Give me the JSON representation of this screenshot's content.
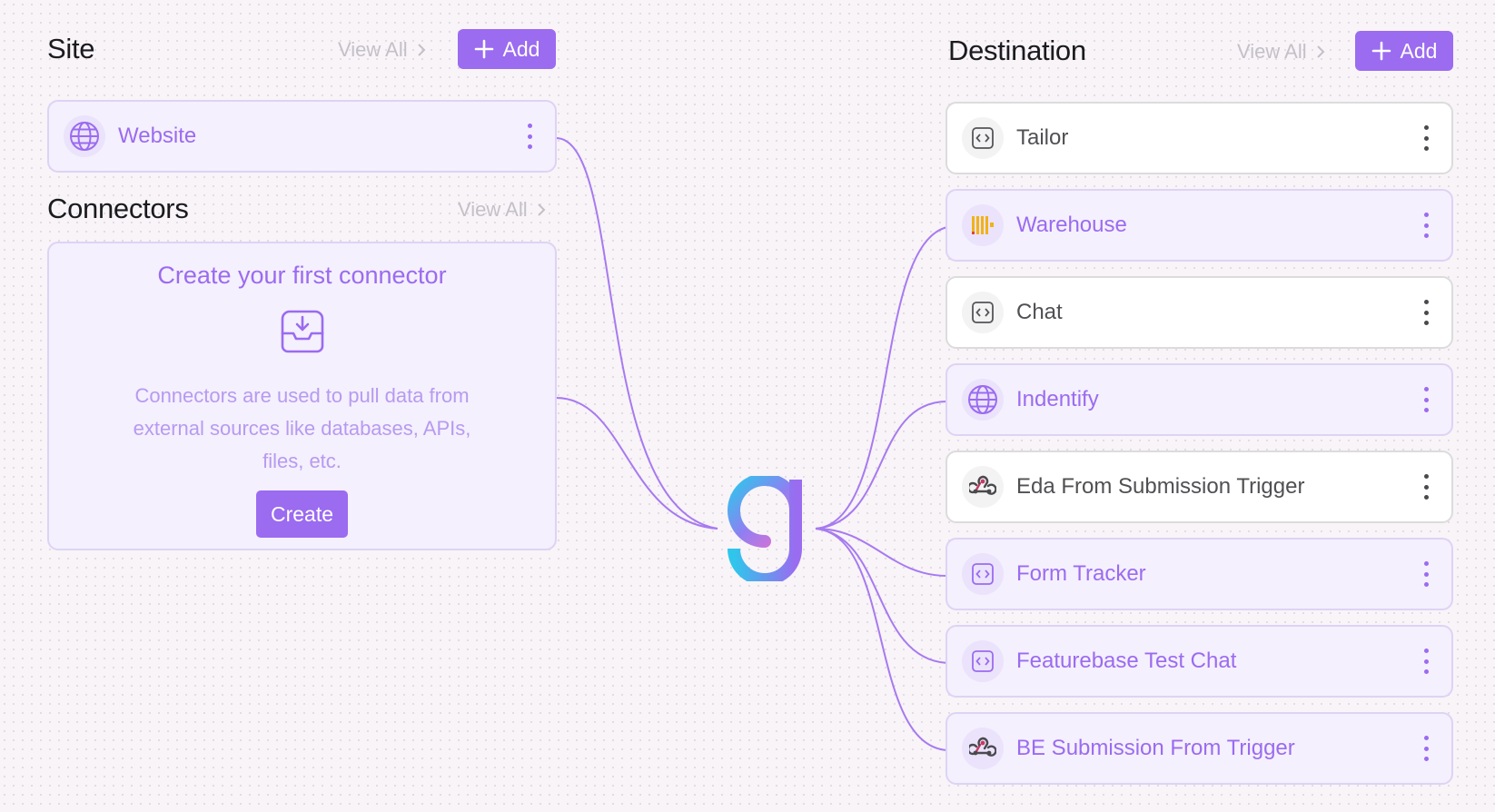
{
  "site": {
    "title": "Site",
    "view_all": "View All",
    "add_label": "Add",
    "items": [
      {
        "label": "Website",
        "icon": "globe-icon"
      }
    ]
  },
  "connectors": {
    "title": "Connectors",
    "view_all": "View All",
    "empty_title": "Create your first connector",
    "empty_description": "Connectors are used to pull data from external sources like databases, APIs, files, etc.",
    "create_label": "Create",
    "empty_icon": "inbox-download-icon"
  },
  "destination": {
    "title": "Destination",
    "view_all": "View All",
    "add_label": "Add",
    "items": [
      {
        "label": "Tailor",
        "icon": "code-icon",
        "status": "inactive"
      },
      {
        "label": "Warehouse",
        "icon": "warehouse-icon",
        "status": "active"
      },
      {
        "label": "Chat",
        "icon": "code-icon",
        "status": "inactive"
      },
      {
        "label": "Indentify",
        "icon": "globe-icon",
        "status": "active"
      },
      {
        "label": "Eda From Submission Trigger",
        "icon": "webhook-icon",
        "status": "inactive"
      },
      {
        "label": "Form Tracker",
        "icon": "code-icon",
        "status": "active"
      },
      {
        "label": "Featurebase Test Chat",
        "icon": "code-icon",
        "status": "active"
      },
      {
        "label": "BE Submission From Trigger",
        "icon": "webhook-icon",
        "status": "active"
      }
    ]
  },
  "center_logo": "brand-logo-icon",
  "colors": {
    "accent": "#9b6bf0",
    "active_bg": "#f4f0fd",
    "active_border": "#ddd3f5",
    "inactive_bg": "#ffffff",
    "inactive_border": "#dcdcdc",
    "line": "#a77af0"
  }
}
